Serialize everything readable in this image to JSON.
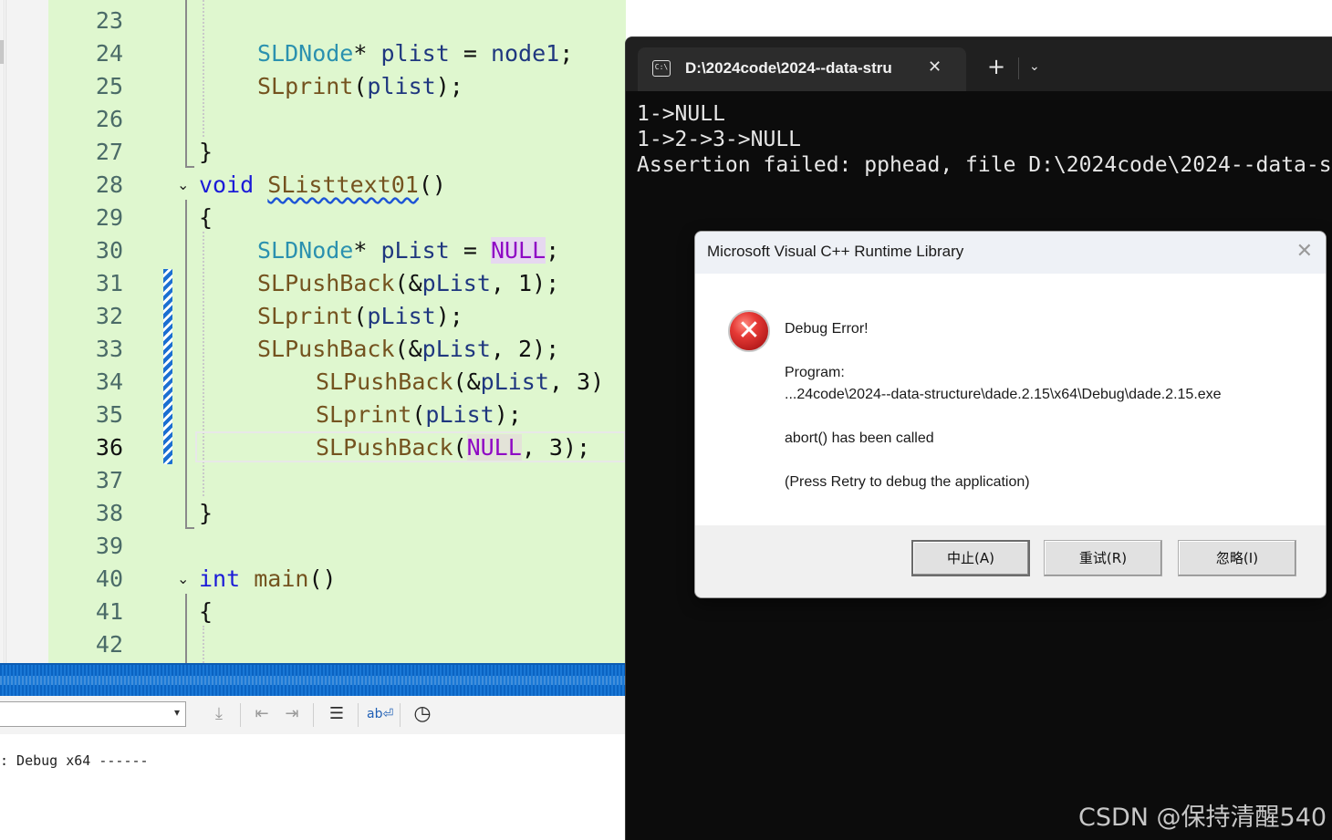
{
  "editor": {
    "lines": [
      {
        "n": "23",
        "code": ""
      },
      {
        "n": "24",
        "code": "SLDNode* plist = node1;"
      },
      {
        "n": "25",
        "code": "SLprint(plist);"
      },
      {
        "n": "26",
        "code": ""
      },
      {
        "n": "27",
        "code": "}"
      },
      {
        "n": "28",
        "code": "void SListtext01()"
      },
      {
        "n": "29",
        "code": "{"
      },
      {
        "n": "30",
        "code": "SLDNode* pList = NULL;"
      },
      {
        "n": "31",
        "code": "SLPushBack(&pList, 1);"
      },
      {
        "n": "32",
        "code": "SLprint(pList);"
      },
      {
        "n": "33",
        "code": "SLPushBack(&pList, 2);"
      },
      {
        "n": "34",
        "code": "SLPushBack(&pList, 3)"
      },
      {
        "n": "35",
        "code": "SLprint(pList);"
      },
      {
        "n": "36",
        "code": "SLPushBack(NULL, 3);"
      },
      {
        "n": "37",
        "code": ""
      },
      {
        "n": "38",
        "code": "}"
      },
      {
        "n": "39",
        "code": ""
      },
      {
        "n": "40",
        "code": "int main()"
      },
      {
        "n": "41",
        "code": "{"
      },
      {
        "n": "42",
        "code": ""
      }
    ],
    "tokens": {
      "SLDNode": "SLDNode",
      "star": "*",
      "plist": "plist",
      "eq": "=",
      "node1": "node1",
      "semi": ";",
      "SLprint": "SLprint",
      "lp": "(",
      "rp": ")",
      "rbrace": "}",
      "lbrace": "{",
      "void": "void",
      "SListtext01": "SListtext01",
      "parens": "()",
      "pList": "pList",
      "NULL": "NULL",
      "SLPushBack": "SLPushBack",
      "amp": "&",
      "comma": ",",
      "one": "1",
      "two": "2",
      "three": "3",
      "int": "int",
      "main": "main"
    },
    "current_line": "36"
  },
  "output": {
    "text": ": Debug x64 ------"
  },
  "terminal": {
    "tab_title": "D:\\2024code\\2024--data-stru",
    "tab_icon_text": "C:\\",
    "new_tab": "+",
    "menu": "⌄",
    "close": "✕",
    "lines": [
      "1->NULL",
      "1->2->3->NULL",
      "Assertion failed: pphead, file D:\\2024code\\2024--data-s"
    ]
  },
  "dialog": {
    "title": "Microsoft Visual C++ Runtime Library",
    "close": "✕",
    "heading": "Debug Error!",
    "program_label": "Program:",
    "program_path": "...24code\\2024--data-structure\\dade.2.15\\x64\\Debug\\dade.2.15.exe",
    "abort": "abort() has been called",
    "hint": "(Press Retry to debug the application)",
    "buttons": {
      "abort": "中止(A)",
      "retry": "重试(R)",
      "ignore": "忽略(I)"
    }
  },
  "watermark": "CSDN @保持清醒540",
  "colors": {
    "code_bg": "#dff7cf",
    "keyword": "#1b1bd8",
    "type": "#2b91af",
    "function": "#74531f",
    "variable": "#1f377f",
    "macro": "#8f08c4",
    "terminal_bg": "#0c0c0c",
    "status_blue": "#0a63c2"
  }
}
